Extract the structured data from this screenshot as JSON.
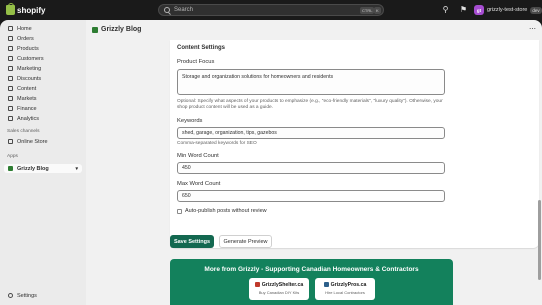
{
  "topbar": {
    "brand": "shopify",
    "search_placeholder": "Search",
    "shortcut_key1": "CTRL",
    "shortcut_key2": "K",
    "store_avatar": "gt",
    "store_name": "grizzly-test-store",
    "dev_badge": "dev"
  },
  "sidebar": {
    "items": [
      {
        "label": "Home",
        "icon": "home-icon"
      },
      {
        "label": "Orders",
        "icon": "inbox-icon"
      },
      {
        "label": "Products",
        "icon": "tag-icon"
      },
      {
        "label": "Customers",
        "icon": "person-icon"
      },
      {
        "label": "Marketing",
        "icon": "target-icon"
      },
      {
        "label": "Discounts",
        "icon": "discount-icon"
      },
      {
        "label": "Content",
        "icon": "file-icon"
      },
      {
        "label": "Markets",
        "icon": "globe-icon"
      },
      {
        "label": "Finance",
        "icon": "bank-icon"
      },
      {
        "label": "Analytics",
        "icon": "chart-icon"
      }
    ],
    "sales_channels_label": "Sales channels",
    "online_store": "Online Store",
    "apps_label": "Apps",
    "app_item": "Grizzly Blog",
    "settings": "Settings"
  },
  "app": {
    "title": "Grizzly Blog",
    "more_label": "⋯"
  },
  "form": {
    "section_title": "Content Settings",
    "product_focus_label": "Product Focus",
    "product_focus_value": "Storage and organization solutions for homeowners and residents",
    "product_focus_help": "Optional: Specify what aspects of your products to emphasize (e.g., \"eco-friendly materials\", \"luxury quality\"). Otherwise, your shop product content will be used as a guide.",
    "keywords_label": "Keywords",
    "keywords_value": "shed, garage, organization, tips, gazebos",
    "keywords_help": "Comma-separated keywords for SEO",
    "min_word_label": "Min Word Count",
    "min_word_value": "450",
    "max_word_label": "Max Word Count",
    "max_word_value": "650",
    "auto_publish_label": "Auto-publish posts without review",
    "auto_publish_checked": false
  },
  "actions": {
    "save": "Save Settings",
    "preview": "Generate Preview"
  },
  "banner": {
    "title": "More from Grizzly - Supporting Canadian Homeowners & Contractors",
    "cards": [
      {
        "title": "GrizzlyShelter.ca",
        "subtitle": "Buy Canadian DIY Kits"
      },
      {
        "title": "GrizzlyPros.ca",
        "subtitle": "Hire Local Contractors"
      }
    ]
  },
  "colors": {
    "primary": "#136850",
    "banner": "#13815c",
    "sidebar_bg": "#ebebeb",
    "topbar_bg": "#1a1a1a"
  }
}
